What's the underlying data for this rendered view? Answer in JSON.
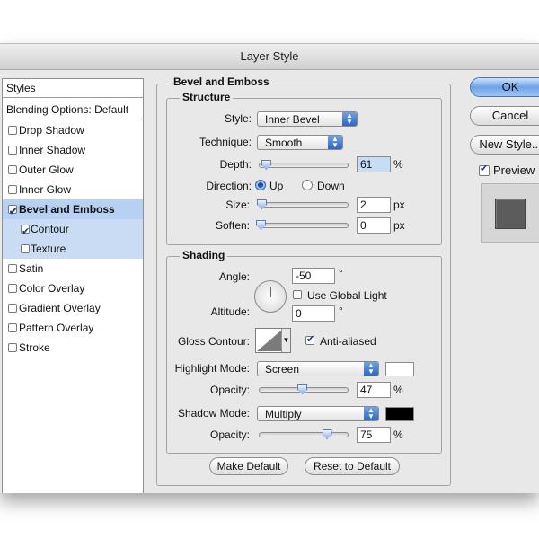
{
  "window": {
    "title": "Layer Style"
  },
  "styles_panel": {
    "header": "Styles",
    "blending_options": "Blending Options: Default",
    "items": [
      {
        "label": "Drop Shadow",
        "checked": false
      },
      {
        "label": "Inner Shadow",
        "checked": false
      },
      {
        "label": "Outer Glow",
        "checked": false
      },
      {
        "label": "Inner Glow",
        "checked": false
      },
      {
        "label": "Bevel and Emboss",
        "checked": true,
        "selected": true
      },
      {
        "label": "Contour",
        "checked": true,
        "sub": true
      },
      {
        "label": "Texture",
        "checked": false,
        "sub": true
      },
      {
        "label": "Satin",
        "checked": false
      },
      {
        "label": "Color Overlay",
        "checked": false
      },
      {
        "label": "Gradient Overlay",
        "checked": false
      },
      {
        "label": "Pattern Overlay",
        "checked": false
      },
      {
        "label": "Stroke",
        "checked": false
      }
    ]
  },
  "bevel": {
    "title": "Bevel and Emboss",
    "structure": {
      "title": "Structure",
      "style_label": "Style:",
      "style_value": "Inner Bevel",
      "technique_label": "Technique:",
      "technique_value": "Smooth",
      "depth_label": "Depth:",
      "depth_value": "61",
      "depth_unit": "%",
      "depth_level": 0.06,
      "direction_label": "Direction:",
      "direction_up": "Up",
      "direction_down": "Down",
      "direction_selected": "Up",
      "size_label": "Size:",
      "size_value": "2",
      "size_unit": "px",
      "size_level": 0.01,
      "soften_label": "Soften:",
      "soften_value": "0",
      "soften_unit": "px",
      "soften_level": 0.0
    },
    "shading": {
      "title": "Shading",
      "angle_label": "Angle:",
      "angle_value": "-50",
      "angle_unit": "°",
      "use_global_light": "Use Global Light",
      "use_global_light_checked": false,
      "altitude_label": "Altitude:",
      "altitude_value": "0",
      "altitude_unit": "°",
      "gloss_contour_label": "Gloss Contour:",
      "anti_aliased": "Anti-aliased",
      "anti_aliased_checked": true,
      "highlight_mode_label": "Highlight Mode:",
      "highlight_mode_value": "Screen",
      "highlight_color": "#ffffff",
      "highlight_opacity_label": "Opacity:",
      "highlight_opacity_value": "47",
      "highlight_opacity_unit": "%",
      "highlight_opacity_level": 0.47,
      "shadow_mode_label": "Shadow Mode:",
      "shadow_mode_value": "Multiply",
      "shadow_color": "#000000",
      "shadow_opacity_label": "Opacity:",
      "shadow_opacity_value": "75",
      "shadow_opacity_unit": "%",
      "shadow_opacity_level": 0.75
    },
    "make_default": "Make Default",
    "reset_to_default": "Reset to Default"
  },
  "actions": {
    "ok": "OK",
    "cancel": "Cancel",
    "new_style": "New Style...",
    "preview": "Preview",
    "preview_checked": true
  }
}
